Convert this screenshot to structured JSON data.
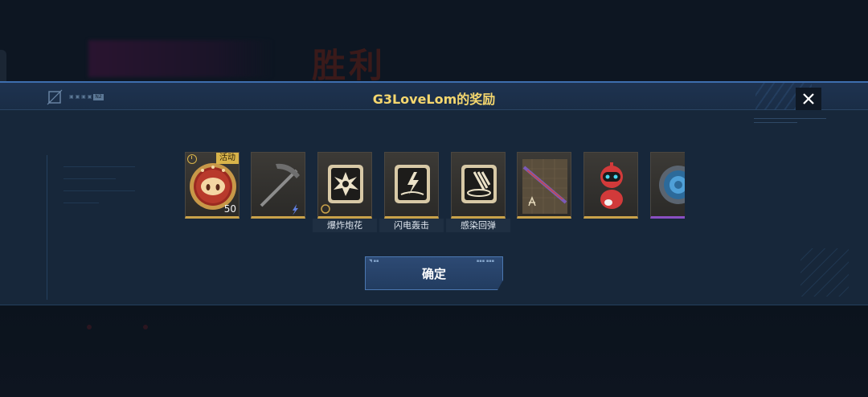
{
  "background": {
    "title": "胜利"
  },
  "modal": {
    "title_player": "G3LoveLom",
    "title_suffix": "的奖励",
    "header_deco_line1": "▣ ▣ ▣ ▣",
    "header_deco_tag": "N2",
    "close_icon": "close-icon"
  },
  "rewards": [
    {
      "name": "pig-coin-token",
      "icon": "pig-coin-icon",
      "tag": "活动",
      "quantity": "50",
      "label": "",
      "rarity_color": "#c9a24a"
    },
    {
      "name": "pickaxe-melee",
      "icon": "pickaxe-icon",
      "tag": "",
      "quantity": "",
      "label": "",
      "rarity_color": "#c9a24a"
    },
    {
      "name": "explosive-firework",
      "icon": "explosion-skill-icon",
      "tag": "",
      "quantity": "",
      "label": "爆炸炮花",
      "rarity_color": "#c9a24a"
    },
    {
      "name": "lightning-strike",
      "icon": "lightning-skill-icon",
      "tag": "",
      "quantity": "",
      "label": "闪电轰击",
      "rarity_color": "#c9a24a"
    },
    {
      "name": "infection-rebound",
      "icon": "rebound-skill-icon",
      "tag": "",
      "quantity": "",
      "label": "感染回弹",
      "rarity_color": "#c9a24a"
    },
    {
      "name": "blueprint-weapon",
      "icon": "blueprint-icon",
      "tag": "",
      "quantity": "",
      "label": "",
      "rarity_color": "#c9a24a"
    },
    {
      "name": "red-robot-pet",
      "icon": "robot-pet-icon",
      "tag": "",
      "quantity": "",
      "label": "",
      "rarity_color": "#c9a24a"
    },
    {
      "name": "blue-badge",
      "icon": "badge-icon",
      "tag": "",
      "quantity": "",
      "label": "",
      "rarity_color": "#8a4fc2"
    }
  ],
  "confirm": {
    "label": "确定"
  },
  "colors": {
    "accent_gold": "#f5d76e",
    "modal_bg": "#17273a",
    "button_blue": "#2d4a74"
  }
}
